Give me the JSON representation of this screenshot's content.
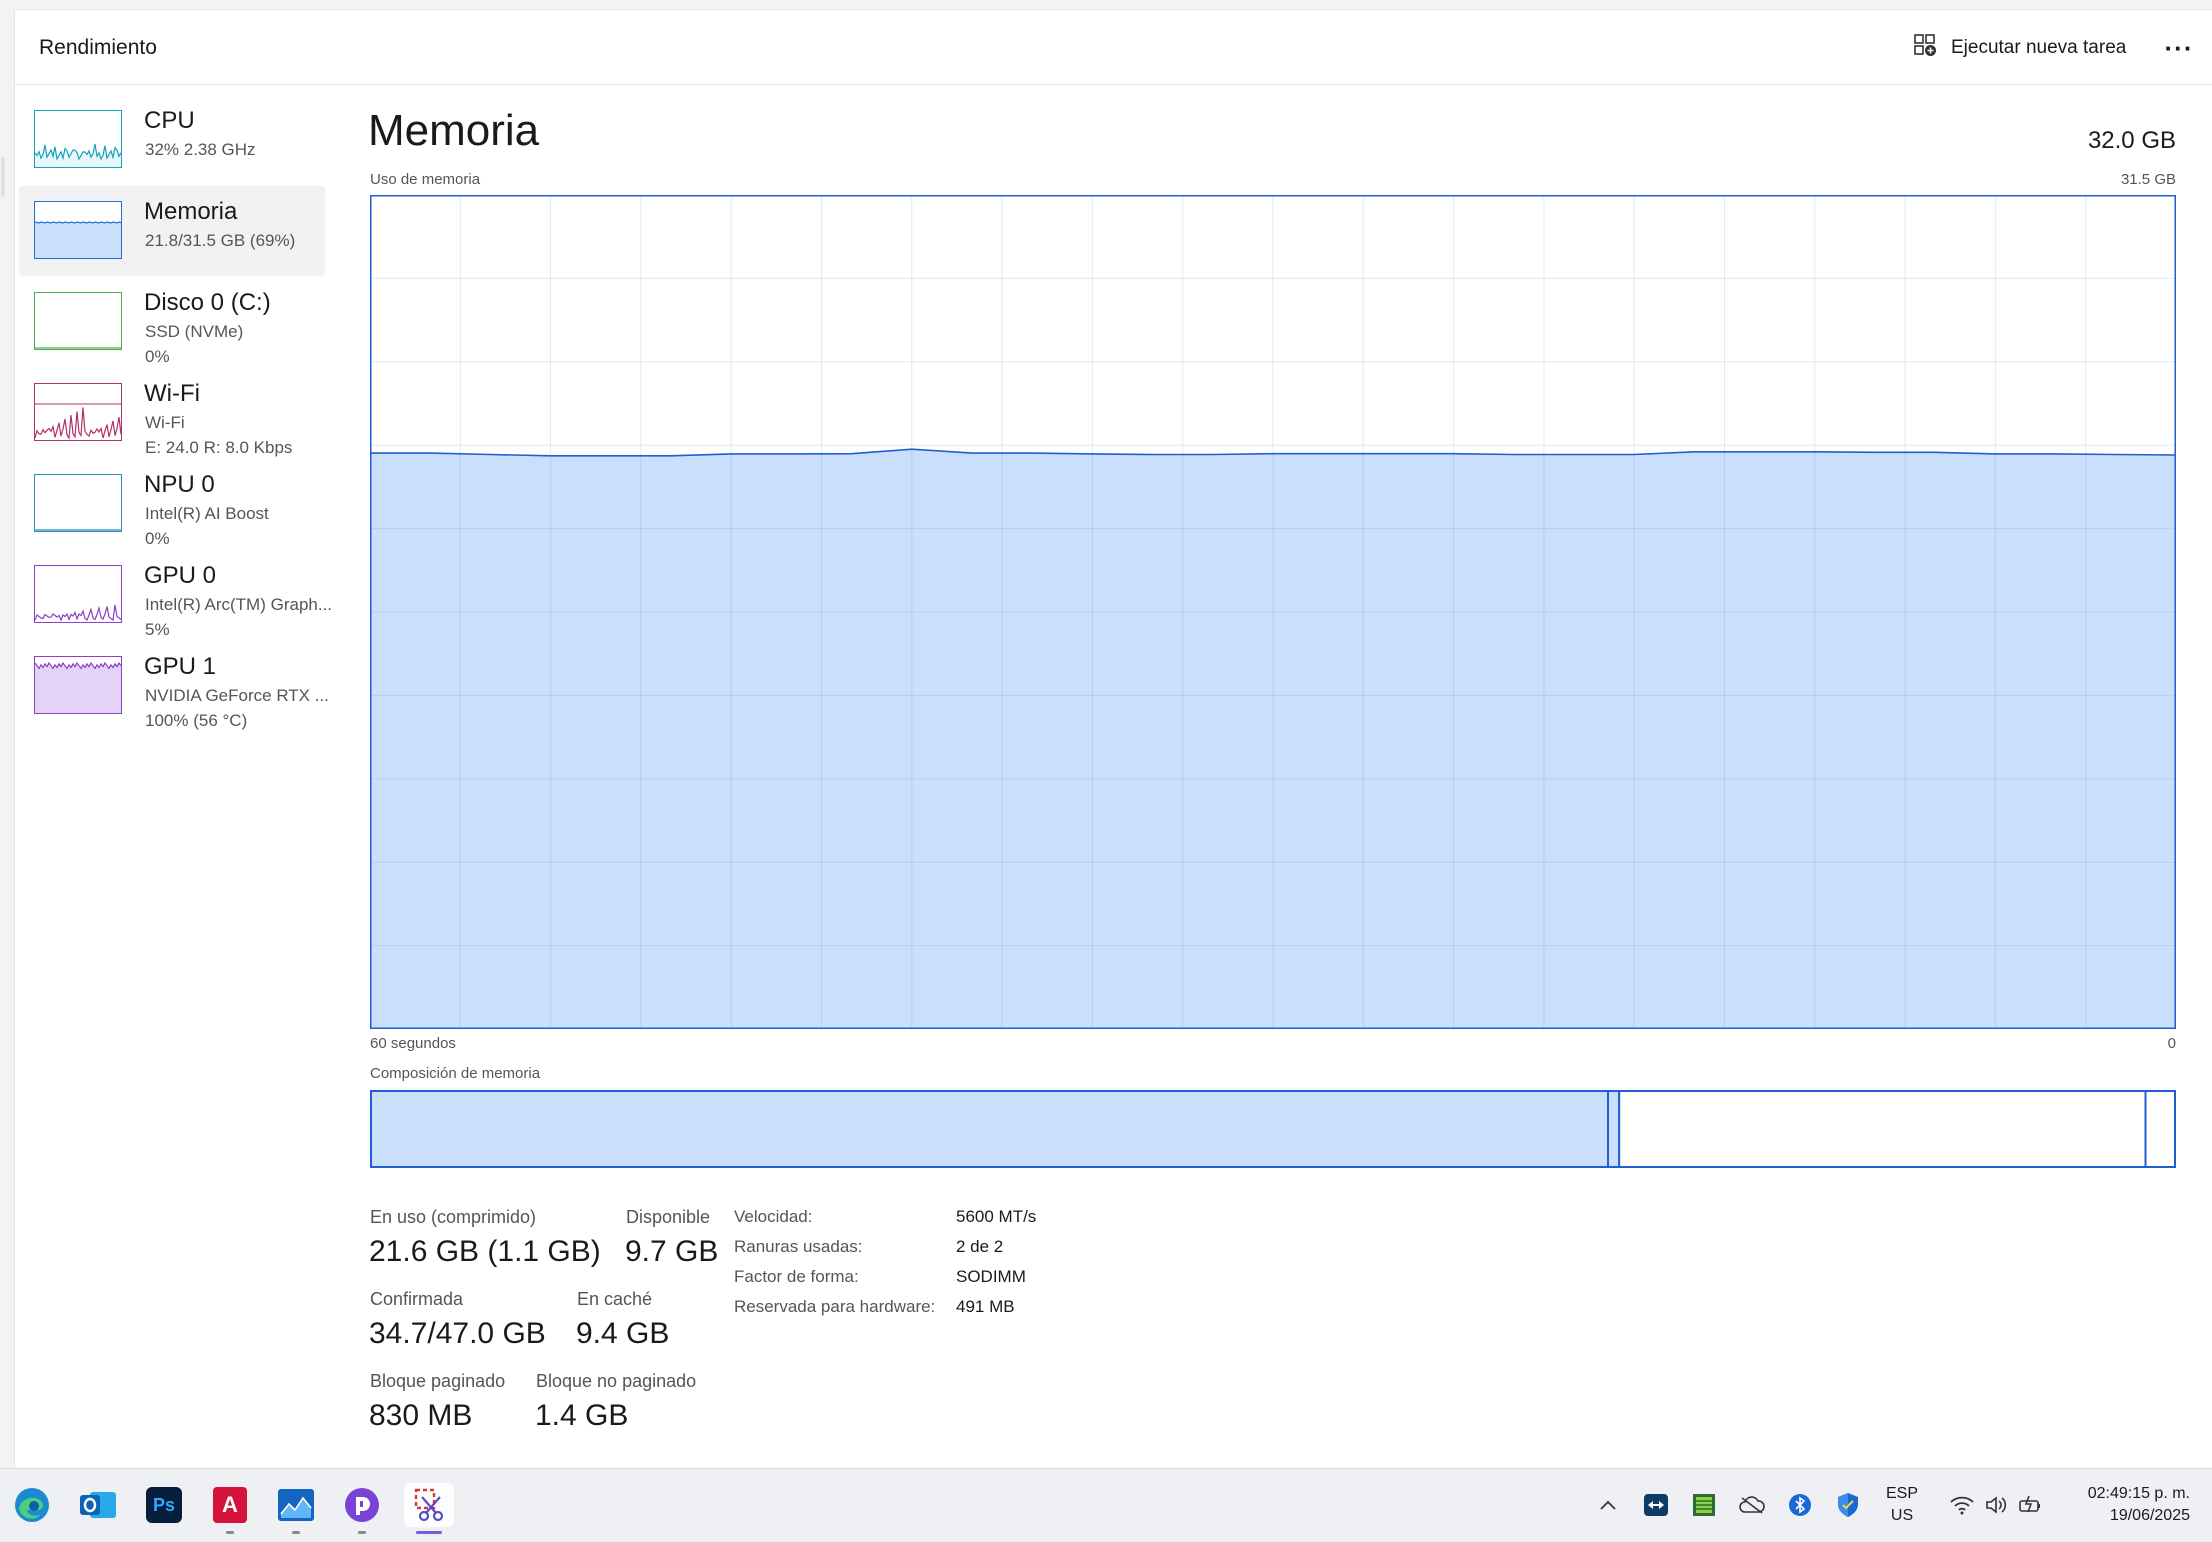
{
  "window": {
    "title": "Rendimiento",
    "new_task_label": "Ejecutar nueva tarea",
    "more_label": "···"
  },
  "sidebar": {
    "items": [
      {
        "name": "CPU",
        "line1": "32%  2.38 GHz",
        "line2": "",
        "color": "#17a2b8",
        "fill": "#e8f7f9",
        "active": false
      },
      {
        "name": "Memoria",
        "line1": "21.8/31.5 GB (69%)",
        "line2": "",
        "color": "#1f6fd6",
        "fill": "#c9dffb",
        "active": true
      },
      {
        "name": "Disco 0 (C:)",
        "line1": "SSD (NVMe)",
        "line2": "0%",
        "color": "#4caf50",
        "fill": "#ffffff",
        "active": false
      },
      {
        "name": "Wi-Fi",
        "line1": "Wi-Fi",
        "line2": "E: 24.0  R: 8.0 Kbps",
        "color": "#b0306a",
        "fill": "#ffffff",
        "active": false
      },
      {
        "name": "NPU 0",
        "line1": "Intel(R) AI Boost",
        "line2": "0%",
        "color": "#2a8fbd",
        "fill": "#ffffff",
        "active": false
      },
      {
        "name": "GPU 0",
        "line1": "Intel(R) Arc(TM) Graph...",
        "line2": "5%",
        "color": "#8a3fc4",
        "fill": "#ffffff",
        "active": false
      },
      {
        "name": "GPU 1",
        "line1": "NVIDIA GeForce RTX ...",
        "line2": "100%  (56 °C)",
        "color": "#8a3fc4",
        "fill": "#e3d3f7",
        "active": false
      }
    ]
  },
  "main": {
    "heading": "Memoria",
    "total": "32.0 GB",
    "usage_label": "Uso de memoria",
    "usage_max": "31.5 GB",
    "time_left": "60 segundos",
    "time_right": "0",
    "composition_label": "Composición de memoria",
    "accent_color": "#1f5fd1",
    "fill_color": "#c9dffb"
  },
  "chart_data": {
    "type": "area",
    "title": "Uso de memoria",
    "xlabel": "",
    "ylabel": "",
    "xlim": [
      60,
      0
    ],
    "ylim": [
      0,
      31.5
    ],
    "grid": true,
    "x": [
      60,
      58,
      56,
      54,
      52,
      50,
      48,
      46,
      44,
      42,
      40,
      38,
      36,
      34,
      32,
      30,
      28,
      26,
      24,
      22,
      20,
      18,
      16,
      14,
      12,
      10,
      8,
      6,
      4,
      2,
      0
    ],
    "series": [
      {
        "values": [
          21.75,
          21.75,
          21.7,
          21.65,
          21.65,
          21.65,
          21.72,
          21.72,
          21.73,
          21.9,
          21.75,
          21.75,
          21.72,
          21.7,
          21.7,
          21.73,
          21.73,
          21.73,
          21.73,
          21.7,
          21.7,
          21.7,
          21.8,
          21.8,
          21.8,
          21.78,
          21.78,
          21.72,
          21.72,
          21.7,
          21.68
        ]
      }
    ]
  },
  "composition": {
    "in_use_fraction": 0.6855,
    "modified_fraction": 0.0062,
    "standby_fraction": 0.2914,
    "free_fraction": 0.0169
  },
  "stats": {
    "in_use_label": "En uso (comprimido)",
    "in_use_value": "21.6 GB (1.1 GB)",
    "available_label": "Disponible",
    "available_value": "9.7 GB",
    "committed_label": "Confirmada",
    "committed_value": "34.7/47.0 GB",
    "cached_label": "En caché",
    "cached_value": "9.4 GB",
    "paged_label": "Bloque paginado",
    "paged_value": "830 MB",
    "nonpaged_label": "Bloque no paginado",
    "nonpaged_value": "1.4 GB"
  },
  "details": [
    {
      "key": "Velocidad:",
      "value": "5600 MT/s"
    },
    {
      "key": "Ranuras usadas:",
      "value": "2 de 2"
    },
    {
      "key": "Factor de forma:",
      "value": "SODIMM"
    },
    {
      "key": "Reservada para hardware:",
      "value": "491 MB"
    }
  ],
  "taskbar": {
    "apps": [
      "edge-icon",
      "outlook-icon",
      "photoshop-icon",
      "autocad-icon",
      "stocks-icon",
      "clipchamp-icon",
      "snipping-tool-icon"
    ],
    "ps_label": "Ps",
    "cad_label": "A",
    "lang_line1": "ESP",
    "lang_line2": "US",
    "time": "02:49:15 p. m.",
    "date": "19/06/2025"
  }
}
